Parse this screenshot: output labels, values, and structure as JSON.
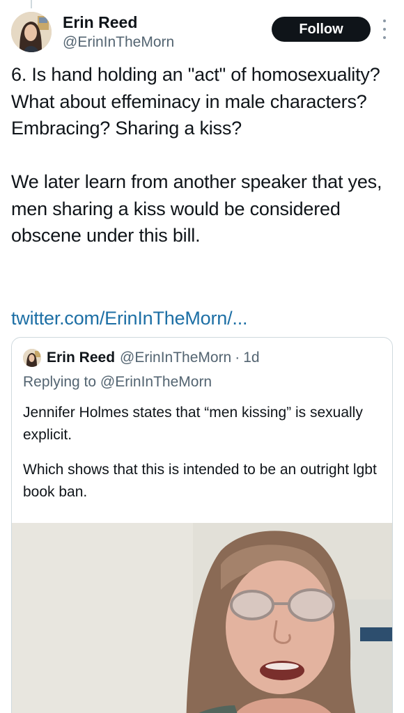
{
  "author": {
    "display_name": "Erin Reed",
    "handle": "@ErinInTheMorn"
  },
  "actions": {
    "follow_label": "Follow",
    "more_icon": "more-vertical-icon"
  },
  "tweet": {
    "paragraphs": [
      "6. Is hand holding an \"act\" of homosexuality? What about effeminacy in male characters? Embracing? Sharing a kiss?",
      "We later learn from another speaker that yes, men sharing a kiss would be considered obscene under this bill."
    ],
    "link_text": "twitter.com/ErinInTheMorn/..."
  },
  "quoted_tweet": {
    "display_name": "Erin Reed",
    "handle": "@ErinInTheMorn",
    "separator": "·",
    "time": "1d",
    "replying_prefix": "Replying to",
    "replying_handle": "@ErinInTheMorn",
    "paragraphs": [
      "Jennifer Holmes states that “men kissing” is sexually explicit.",
      "Which shows that this is intended to be an outright lgbt book ban."
    ],
    "media": "video-still-of-speaker"
  },
  "colors": {
    "follow_bg": "#0f1419",
    "link": "#1d6fa5",
    "secondary_text": "#536471",
    "border": "#cfd9de"
  }
}
